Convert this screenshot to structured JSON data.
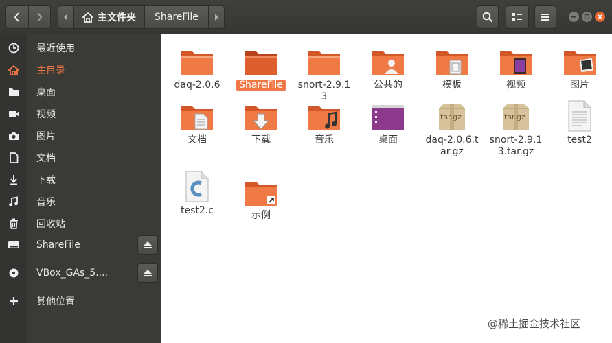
{
  "path_bar": {
    "home_label": "主文件夹",
    "current_label": "ShareFile"
  },
  "sidebar": {
    "items": [
      {
        "label": "最近使用",
        "icon": "clock-icon"
      },
      {
        "label": "主目录",
        "icon": "home-icon",
        "active": true
      },
      {
        "label": "桌面",
        "icon": "folder-icon"
      },
      {
        "label": "视频",
        "icon": "video-icon"
      },
      {
        "label": "图片",
        "icon": "camera-icon"
      },
      {
        "label": "文档",
        "icon": "document-icon"
      },
      {
        "label": "下载",
        "icon": "download-icon"
      },
      {
        "label": "音乐",
        "icon": "music-icon"
      },
      {
        "label": "回收站",
        "icon": "trash-icon"
      },
      {
        "label": "ShareFile",
        "icon": "drive-icon"
      },
      {
        "label": "VBox_GAs_5....",
        "icon": "disc-icon"
      },
      {
        "label": "其他位置",
        "icon": "plus-icon"
      }
    ]
  },
  "files": [
    {
      "name": "daq-2.0.6",
      "icon": "folder-icon"
    },
    {
      "name": "ShareFile",
      "icon": "folder-icon",
      "selected": true
    },
    {
      "name": "snort-2.9.13",
      "icon": "folder-icon"
    },
    {
      "name": "公共的",
      "icon": "public-folder-icon"
    },
    {
      "name": "模板",
      "icon": "templates-folder-icon"
    },
    {
      "name": "视频",
      "icon": "video-folder-icon"
    },
    {
      "name": "图片",
      "icon": "pictures-folder-icon"
    },
    {
      "name": "文档",
      "icon": "documents-folder-icon"
    },
    {
      "name": "下载",
      "icon": "downloads-folder-icon"
    },
    {
      "name": "音乐",
      "icon": "music-folder-icon"
    },
    {
      "name": "桌面",
      "icon": "desktop-folder-icon"
    },
    {
      "name": "daq-2.0.6.tar.gz",
      "icon": "archive-icon",
      "badge": "tar.gz"
    },
    {
      "name": "snort-2.9.13.tar.gz",
      "icon": "archive-icon",
      "badge": "tar.gz"
    },
    {
      "name": "test2",
      "icon": "text-file-icon"
    },
    {
      "name": "test2.c",
      "icon": "c-source-icon"
    },
    {
      "name": "示例",
      "icon": "examples-folder-icon"
    }
  ],
  "watermark": "@稀土掘金技术社区",
  "colors": {
    "accent": "#f07746",
    "folder": "#e8703b",
    "sidebar": "#3a3a37"
  }
}
